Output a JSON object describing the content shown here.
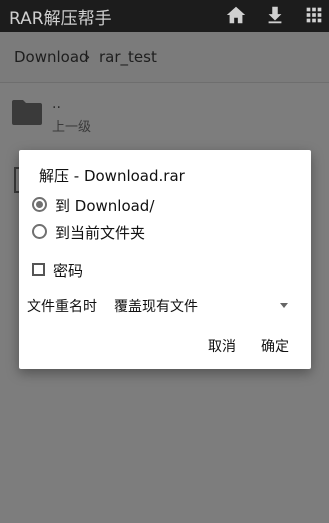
{
  "app": {
    "title": "RAR解压帮手"
  },
  "toolbar": {
    "icons": [
      "home-icon",
      "download-icon",
      "grid-icon"
    ]
  },
  "breadcrumb": {
    "items": [
      "Download",
      "rar_test"
    ],
    "separator": "›"
  },
  "file_list": {
    "items": [
      {
        "name": "..",
        "subtitle": "上一级",
        "icon": "folder-icon"
      }
    ]
  },
  "dialog": {
    "title": "解压 - Download.rar",
    "options": [
      {
        "label": "到 Download/",
        "selected": true
      },
      {
        "label": "到当前文件夹",
        "selected": false
      }
    ],
    "password": {
      "label": "密码",
      "checked": false
    },
    "rename": {
      "label": "文件重名时",
      "value": "覆盖现有文件"
    },
    "buttons": {
      "cancel": "取消",
      "confirm": "确定"
    }
  },
  "colors": {
    "appbar": "#1c1c1c",
    "overlay": "#7d7d7d",
    "dialog": "#ffffff",
    "radio": "#707070"
  }
}
